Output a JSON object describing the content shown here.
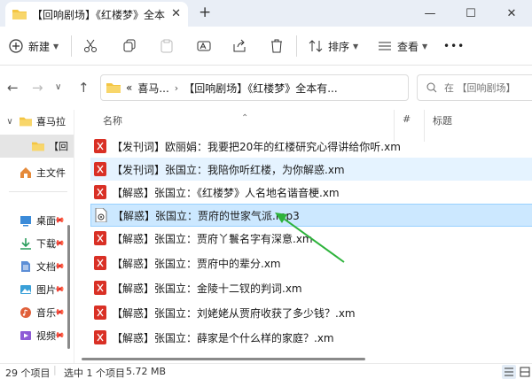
{
  "window": {
    "tab_title": "【回响剧场】《红楼梦》全本有",
    "tab_close": "✕",
    "new_tab": "+",
    "minimize": "—",
    "maximize": "☐",
    "close": "✕"
  },
  "toolbar": {
    "new_label": "新建",
    "sort_label": "排序",
    "view_label": "查看",
    "more_label": "•••"
  },
  "address": {
    "crumb_overflow": "«",
    "crumb_1": "喜马...",
    "crumb_2": "【回响剧场】《红楼梦》全本有...",
    "search_placeholder": "在 【回响剧场】"
  },
  "sidebar": {
    "items": [
      {
        "label": "喜马拉"
      },
      {
        "label": "【回"
      },
      {
        "label": "主文件"
      },
      {
        "label": "桌面"
      },
      {
        "label": "下载"
      },
      {
        "label": "文档"
      },
      {
        "label": "图片"
      },
      {
        "label": "音乐"
      },
      {
        "label": "视频"
      }
    ]
  },
  "columns": {
    "name": "名称",
    "number": "#",
    "title": "标题"
  },
  "files": [
    {
      "name": "【发刊词】欧丽娟：我要把20年的红楼研究心得讲给你听.xm"
    },
    {
      "name": "【发刊词】张国立：我陪你听红楼，为你解惑.xm"
    },
    {
      "name": "【解惑】张国立：《红楼梦》人名地名谐音梗.xm"
    },
    {
      "name": "【解惑】张国立：贾府的世家气派.mp3"
    },
    {
      "name": "【解惑】张国立：贾府丫鬟名字有深意.xm"
    },
    {
      "name": "【解惑】张国立：贾府中的辈分.xm"
    },
    {
      "name": "【解惑】张国立：金陵十二钗的判词.xm"
    },
    {
      "name": "【解惑】张国立：刘姥姥从贾府收获了多少钱？.xm"
    },
    {
      "name": "【解惑】张国立：薛家是个什么样的家庭？.xm"
    }
  ],
  "status": {
    "item_count": "29 个项目",
    "selection": "选中 1 个项目",
    "size": "5.72 MB"
  },
  "colors": {
    "accent": "#0067c0",
    "selection_bg": "#cce8ff",
    "hover_bg": "#e5f3ff",
    "folder": "#f4c542",
    "xm_icon": "#d93025",
    "arrow": "#2db33b"
  }
}
